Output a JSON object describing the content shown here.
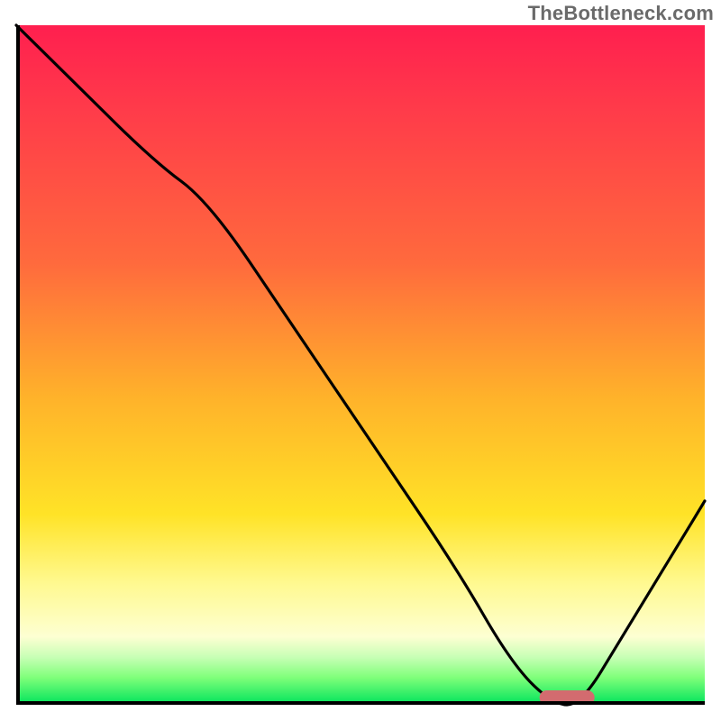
{
  "watermark": "TheBottleneck.com",
  "chart_data": {
    "type": "line",
    "title": "",
    "xlabel": "",
    "ylabel": "",
    "xlim": [
      0,
      100
    ],
    "ylim": [
      0,
      100
    ],
    "background_gradient": {
      "top_color": "#ff1f4f",
      "mid_upper_color": "#ff9a2e",
      "mid_lower_color": "#ffe327",
      "bottom_color": "#00e35b",
      "meaning": "red = high bottleneck, green = low bottleneck"
    },
    "series": [
      {
        "name": "bottleneck-curve",
        "x": [
          0,
          8,
          20,
          28,
          40,
          52,
          64,
          72,
          78,
          82,
          88,
          100
        ],
        "values": [
          100,
          92,
          80,
          74,
          56,
          38,
          20,
          6,
          0,
          0,
          10,
          30
        ]
      }
    ],
    "optimal_range": {
      "x_start": 76,
      "x_end": 84,
      "y": 0
    },
    "colors": {
      "curve": "#000000",
      "marker": "#d36b6f",
      "axis": "#000000"
    }
  }
}
